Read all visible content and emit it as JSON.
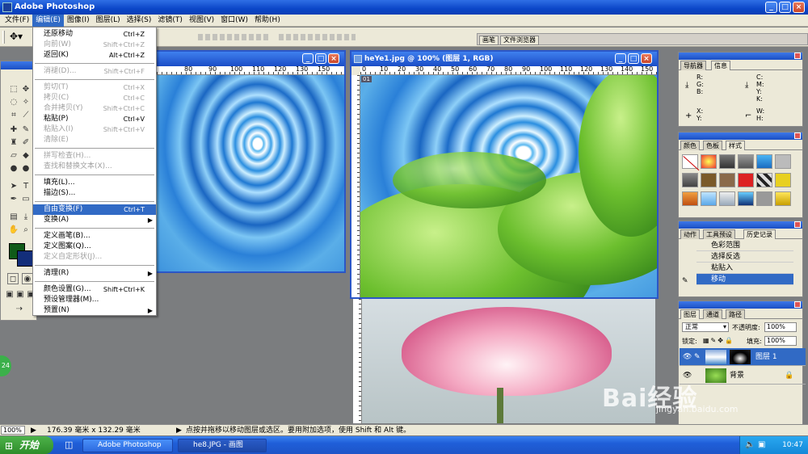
{
  "app": {
    "title": "Adobe Photoshop"
  },
  "menubar": {
    "items": [
      "文件(F)",
      "编辑(E)",
      "图像(I)",
      "图层(L)",
      "选择(S)",
      "滤镜(T)",
      "视图(V)",
      "窗口(W)",
      "帮助(H)"
    ]
  },
  "palette_well": {
    "tabs": [
      "画笔",
      "文件浏览器"
    ]
  },
  "edit_menu": {
    "items": [
      {
        "label": "还原移动",
        "shortcut": "Ctrl+Z"
      },
      {
        "label": "向前(W)",
        "shortcut": "Shift+Ctrl+Z"
      },
      {
        "label": "返回(K)",
        "shortcut": "Alt+Ctrl+Z"
      },
      {
        "label": "消褪(D)...",
        "shortcut": "Shift+Ctrl+F"
      },
      {
        "label": "剪切(T)",
        "shortcut": "Ctrl+X"
      },
      {
        "label": "拷贝(C)",
        "shortcut": "Ctrl+C"
      },
      {
        "label": "合并拷贝(Y)",
        "shortcut": "Shift+Ctrl+C"
      },
      {
        "label": "粘贴(P)",
        "shortcut": "Ctrl+V"
      },
      {
        "label": "粘贴入(I)",
        "shortcut": "Shift+Ctrl+V"
      },
      {
        "label": "清除(E)",
        "shortcut": ""
      },
      {
        "label": "拼写检查(H)...",
        "shortcut": ""
      },
      {
        "label": "查找和替换文本(X)...",
        "shortcut": ""
      },
      {
        "label": "填充(L)...",
        "shortcut": ""
      },
      {
        "label": "描边(S)...",
        "shortcut": ""
      },
      {
        "label": "自由变换(F)",
        "shortcut": "Ctrl+T"
      },
      {
        "label": "变换(A)",
        "shortcut": ""
      },
      {
        "label": "定义画笔(B)...",
        "shortcut": ""
      },
      {
        "label": "定义图案(Q)...",
        "shortcut": ""
      },
      {
        "label": "定义自定形状(J)...",
        "shortcut": ""
      },
      {
        "label": "清理(R)",
        "shortcut": ""
      },
      {
        "label": "颜色设置(G)...",
        "shortcut": "Shift+Ctrl+K"
      },
      {
        "label": "预设管理器(M)...",
        "shortcut": ""
      },
      {
        "label": "预置(N)",
        "shortcut": ""
      }
    ]
  },
  "doc_left": {
    "ruler_labels": [
      "80",
      "90",
      "100",
      "110",
      "120",
      "130",
      "140",
      "150",
      "160"
    ]
  },
  "doc_right": {
    "title": "heYe1.jpg @ 100% (图层 1, RGB)",
    "ruler_labels": [
      "0",
      "10",
      "20",
      "30",
      "40",
      "50",
      "60",
      "70",
      "80",
      "90",
      "100",
      "110",
      "120",
      "130",
      "140",
      "150",
      "160"
    ],
    "thumb_label": "01"
  },
  "navigator": {
    "tabs": [
      "导航器",
      "信息"
    ],
    "rgb": "R:\nG:\nB:",
    "cmyk": "C:\nM:\nY:\nK:",
    "xy": "X:\nY:",
    "wh": "W:\nH:"
  },
  "styles_panel": {
    "tabs": [
      "颜色",
      "色板",
      "样式"
    ]
  },
  "history_panel": {
    "tabs": [
      "动作",
      "工具预设",
      "历史记录"
    ],
    "rows": [
      "色彩范围",
      "选择反选",
      "粘贴入",
      "移动"
    ]
  },
  "layers_panel": {
    "tabs": [
      "图层",
      "通道",
      "路径"
    ],
    "blend_mode": "正常",
    "opacity_label": "不透明度:",
    "opacity": "100%",
    "lock_label": "锁定:",
    "fill_label": "填充:",
    "fill": "100%",
    "layers": [
      {
        "name": "图层 1"
      },
      {
        "name": "背景"
      }
    ]
  },
  "status": {
    "zoom": "100%",
    "doc_size": "176.39 毫米 x 132.29 毫米",
    "hint": "点按并拖移以移动图层或选区。要用附加选项，使用 Shift 和 Alt 键。"
  },
  "taskbar": {
    "start": "开始",
    "tasks": [
      "Adobe Photoshop",
      "he8.JPG - 画图"
    ],
    "clock": "10:47"
  },
  "badge": "24",
  "watermark": {
    "brand": "Bai经验",
    "url": "jingyan.baidu.com"
  },
  "colors": {
    "accent": "#316ac5",
    "foreground": "#0f5a19",
    "background": "#132e7a"
  }
}
